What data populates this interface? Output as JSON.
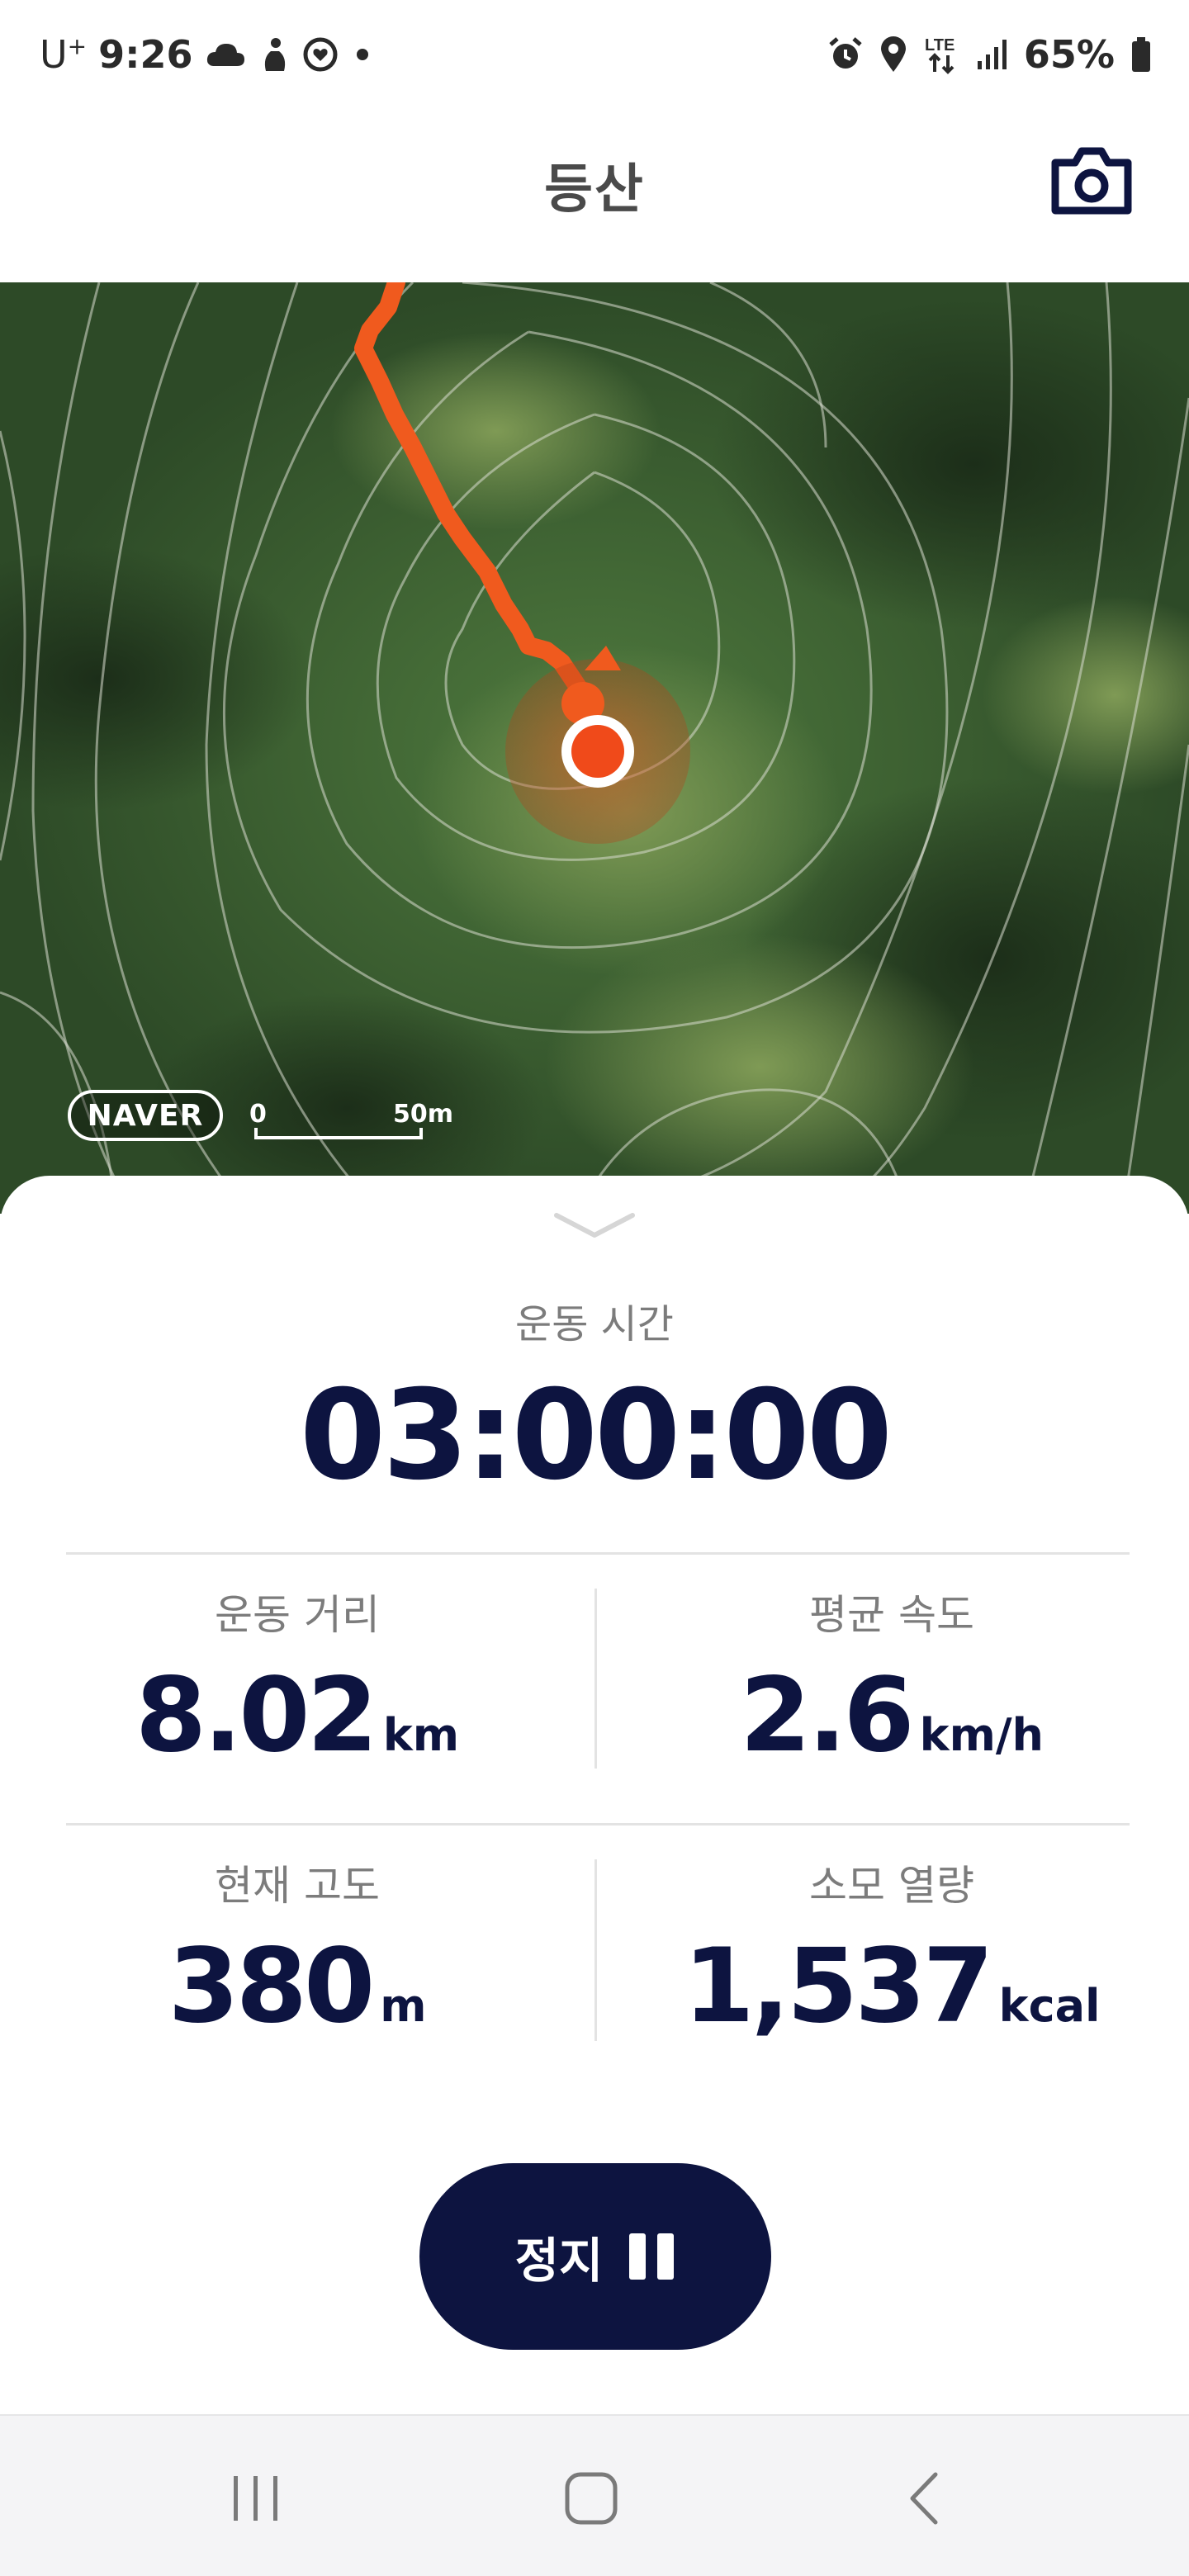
{
  "status_bar": {
    "carrier": "U",
    "carrier_sup": "+",
    "time": "9:26",
    "battery": "65%",
    "network": "LTE",
    "icons": [
      "cloud-icon",
      "person-icon",
      "heart-ring-icon",
      "dot-icon",
      "alarm-icon",
      "location-icon",
      "lte-icon",
      "signal-icon",
      "battery-icon"
    ]
  },
  "header": {
    "title": "등산",
    "camera_icon": "camera-icon"
  },
  "map": {
    "provider": "NAVER",
    "scale_start": "0",
    "scale_end": "50m",
    "route_color": "#f05a1e",
    "marker_color": "#f04a1a"
  },
  "workout": {
    "time_label": "운동 시간",
    "time_value": "03:00:00",
    "stats": [
      {
        "label": "운동 거리",
        "value": "8.02",
        "unit": "km"
      },
      {
        "label": "평균 속도",
        "value": "2.6",
        "unit": "km/h"
      },
      {
        "label": "현재 고도",
        "value": "380",
        "unit": "m"
      },
      {
        "label": "소모 열량",
        "value": "1,537",
        "unit": "kcal"
      }
    ],
    "stop_label": "정지",
    "stop_icon": "pause-icon"
  },
  "nav": {
    "recents_icon": "recents-icon",
    "home_icon": "home-icon",
    "back_icon": "back-icon"
  },
  "colors": {
    "primary": "#0d1440",
    "accent": "#f05a1e",
    "label_gray": "#7c7c7c"
  }
}
